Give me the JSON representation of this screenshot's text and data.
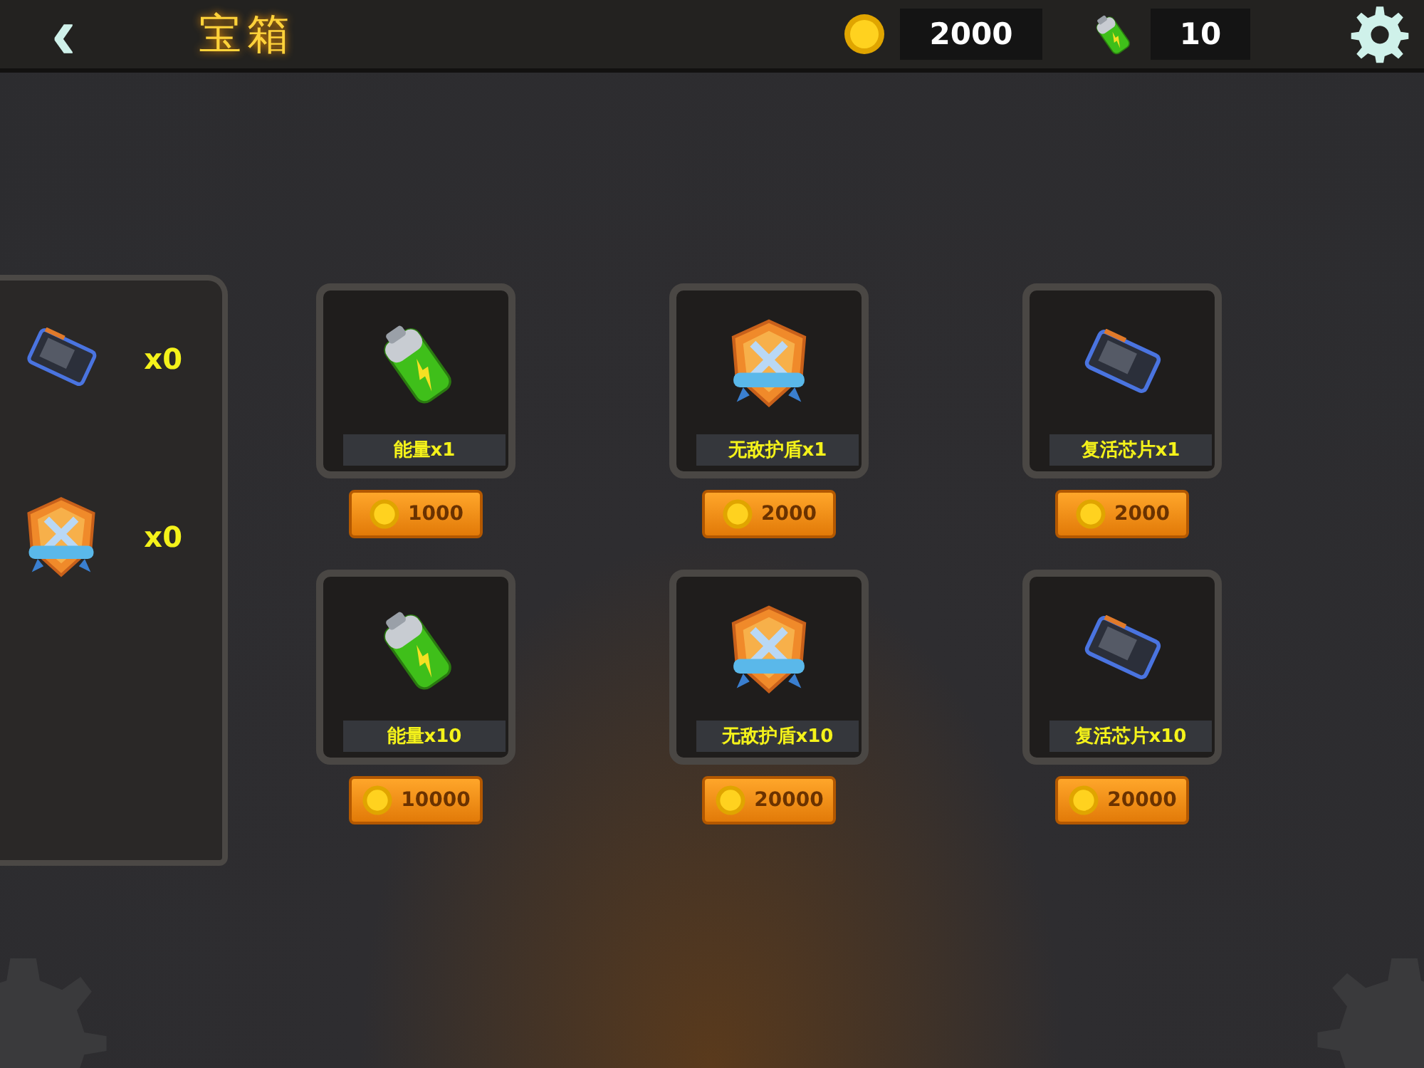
{
  "header": {
    "back": "‹",
    "title": "宝箱",
    "coins": "2000",
    "energy": "10"
  },
  "inventory": [
    {
      "kind": "chip",
      "count": "x0"
    },
    {
      "kind": "shield",
      "count": "x0"
    }
  ],
  "shop": [
    {
      "kind": "battery",
      "name": "能量x1",
      "price": "1000"
    },
    {
      "kind": "shield",
      "name": "无敌护盾x1",
      "price": "2000"
    },
    {
      "kind": "chip",
      "name": "复活芯片x1",
      "price": "2000"
    },
    {
      "kind": "battery",
      "name": "能量x10",
      "price": "10000"
    },
    {
      "kind": "shield",
      "name": "无敌护盾x10",
      "price": "20000"
    },
    {
      "kind": "chip",
      "name": "复活芯片x10",
      "price": "20000"
    }
  ]
}
